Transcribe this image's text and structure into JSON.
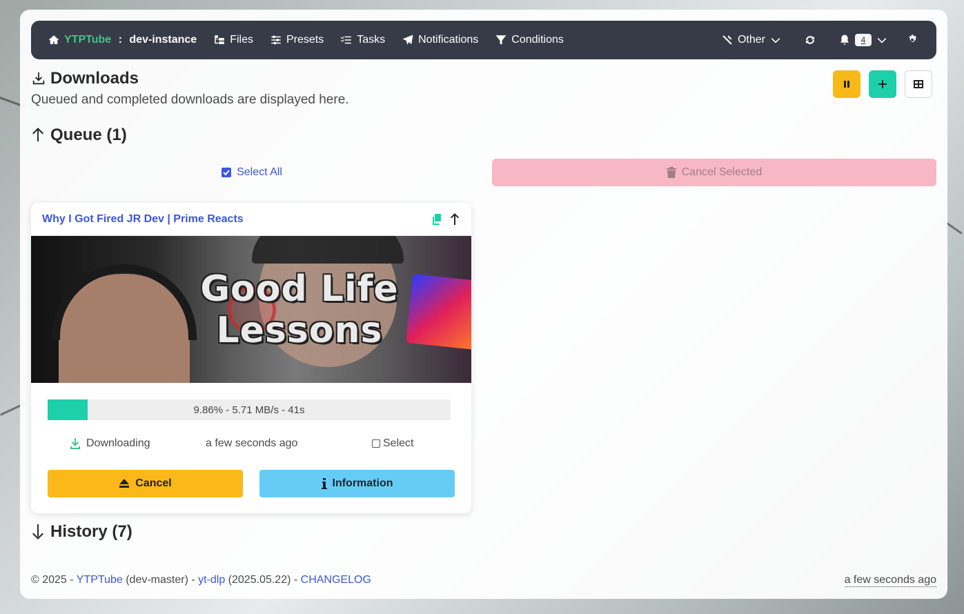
{
  "navbar": {
    "brand_name": "YTPTube",
    "brand_sep": " : ",
    "instance": "dev-instance",
    "files": "Files",
    "presets": "Presets",
    "tasks": "Tasks",
    "notifications": "Notifications",
    "conditions": "Conditions",
    "other": "Other",
    "notification_count": "4"
  },
  "header": {
    "title": "Downloads",
    "subtitle": "Queued and completed downloads are displayed here."
  },
  "queue": {
    "title": "Queue (1)",
    "select_all": "Select All",
    "cancel_selected": "Cancel Selected"
  },
  "item": {
    "title": "Why I Got Fired JR Dev | Prime Reacts",
    "thumb_line1": "Good Life",
    "thumb_line2": "Lessons",
    "progress": 0.0986,
    "progress_text": "9.86% - 5.71 MB/s - 41s",
    "status": "Downloading",
    "time": "a few seconds ago",
    "select_label": "Select",
    "cancel_label": "Cancel",
    "info_label": "Information"
  },
  "history": {
    "title": "History (7)"
  },
  "footer": {
    "copyright": "© 2025 - ",
    "app_link": "YTPTube",
    "version": " (dev-master) - ",
    "ytdlp_link": "yt-dlp",
    "ytdlp_version": " (2025.05.22) - ",
    "changelog_link": "CHANGELOG",
    "updated": "a few seconds ago"
  },
  "colors": {
    "navbar_bg": "#363b47",
    "brand_green": "#3ec487",
    "link_blue": "#3b56d9",
    "progress": "#1ecfac",
    "warning": "#fbb818",
    "info": "#66ccf5",
    "danger_light": "#f8b7c4"
  }
}
